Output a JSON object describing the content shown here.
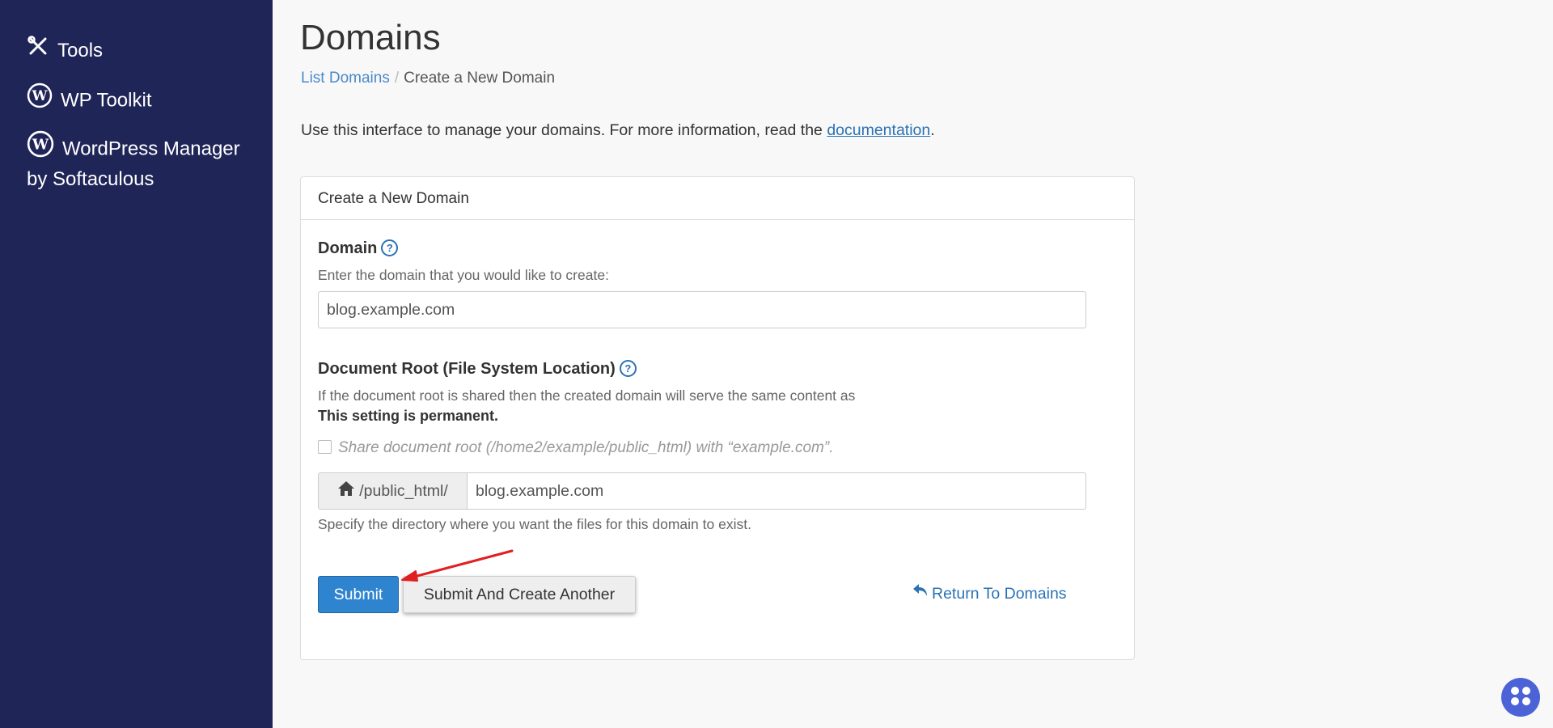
{
  "sidebar": {
    "items": [
      {
        "label": "Tools",
        "icon": "tools-icon"
      },
      {
        "label": "WP Toolkit",
        "icon": "wordpress-icon"
      },
      {
        "label": "WordPress Manager by Softaculous",
        "icon": "wordpress-icon"
      }
    ]
  },
  "header": {
    "title": "Domains",
    "breadcrumb": {
      "link": "List Domains",
      "separator": "/",
      "current": "Create a New Domain"
    }
  },
  "intro": {
    "text": "Use this interface to manage your domains. For more information, read the ",
    "link": "documentation",
    "suffix": "."
  },
  "form": {
    "heading": "Create a New Domain",
    "domain": {
      "label": "Domain",
      "hint": "Enter the domain that you would like to create:",
      "value": "blog.example.com"
    },
    "docroot": {
      "label": "Document Root (File System Location)",
      "hint": "If the document root is shared then the created domain will serve the same content as",
      "permanent": "This setting is permanent.",
      "share_label": "Share document root (/home2/example/public_html) with “example.com”.",
      "share_checked": false,
      "prefix": "/public_html/",
      "value": "blog.example.com",
      "help": "Specify the directory where you want the files for this domain to exist."
    },
    "buttons": {
      "submit": "Submit",
      "submit_another": "Submit And Create Another",
      "return": "Return To Domains"
    }
  },
  "colors": {
    "sidebar_bg": "#202558",
    "primary": "#2f84cf",
    "link": "#2a72b5",
    "annotation_arrow": "#e02020"
  }
}
